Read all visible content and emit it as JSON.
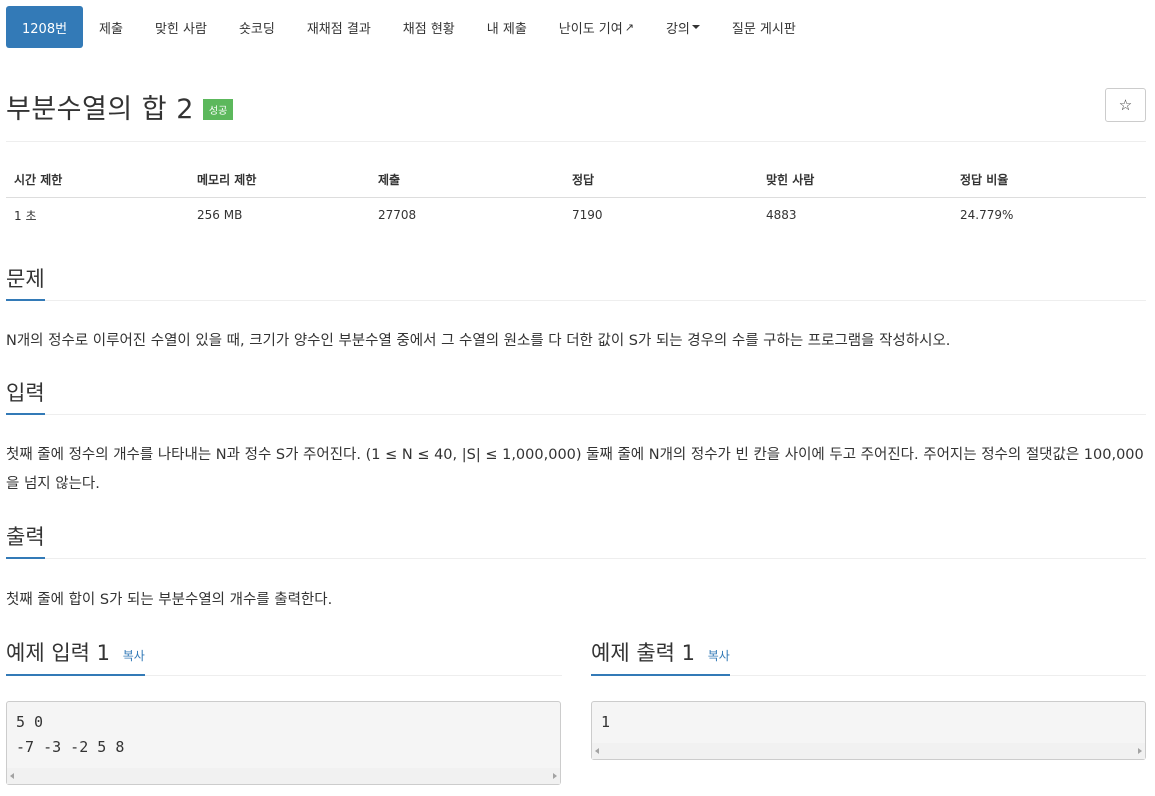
{
  "nav": {
    "items": [
      {
        "label": "1208번",
        "active": true
      },
      {
        "label": "제출"
      },
      {
        "label": "맞힌 사람"
      },
      {
        "label": "숏코딩"
      },
      {
        "label": "재채점 결과"
      },
      {
        "label": "채점 현황"
      },
      {
        "label": "내 제출"
      },
      {
        "label": "난이도 기여",
        "icon": "external-link-icon"
      },
      {
        "label": "강의",
        "icon": "caret-down-icon"
      },
      {
        "label": "질문 게시판"
      }
    ]
  },
  "problem": {
    "title": "부분수열의 합 2",
    "status_badge": "성공",
    "star_icon": "☆"
  },
  "info_table": {
    "headers": [
      "시간 제한",
      "메모리 제한",
      "제출",
      "정답",
      "맞힌 사람",
      "정답 비율"
    ],
    "values": [
      "1 초",
      "256 MB",
      "27708",
      "7190",
      "4883",
      "24.779%"
    ]
  },
  "sections": {
    "description": {
      "heading": "문제",
      "text": "N개의 정수로 이루어진 수열이 있을 때, 크기가 양수인 부분수열 중에서 그 수열의 원소를 다 더한 값이 S가 되는 경우의 수를 구하는 프로그램을 작성하시오."
    },
    "input": {
      "heading": "입력",
      "text": "첫째 줄에 정수의 개수를 나타내는 N과 정수 S가 주어진다. (1 ≤ N ≤ 40, |S| ≤ 1,000,000) 둘째 줄에 N개의 정수가 빈 칸을 사이에 두고 주어진다. 주어지는 정수의 절댓값은 100,000을 넘지 않는다."
    },
    "output": {
      "heading": "출력",
      "text": "첫째 줄에 합이 S가 되는 부분수열의 개수를 출력한다."
    }
  },
  "samples": {
    "input": {
      "heading": "예제 입력 1",
      "copy_label": "복사",
      "lines": [
        "5 0",
        "-7 -3 -2 5 8"
      ]
    },
    "output": {
      "heading": "예제 출력 1",
      "copy_label": "복사",
      "lines": [
        "1"
      ]
    }
  },
  "colors": {
    "accent": "#337ab7",
    "success": "#5cb85c"
  }
}
